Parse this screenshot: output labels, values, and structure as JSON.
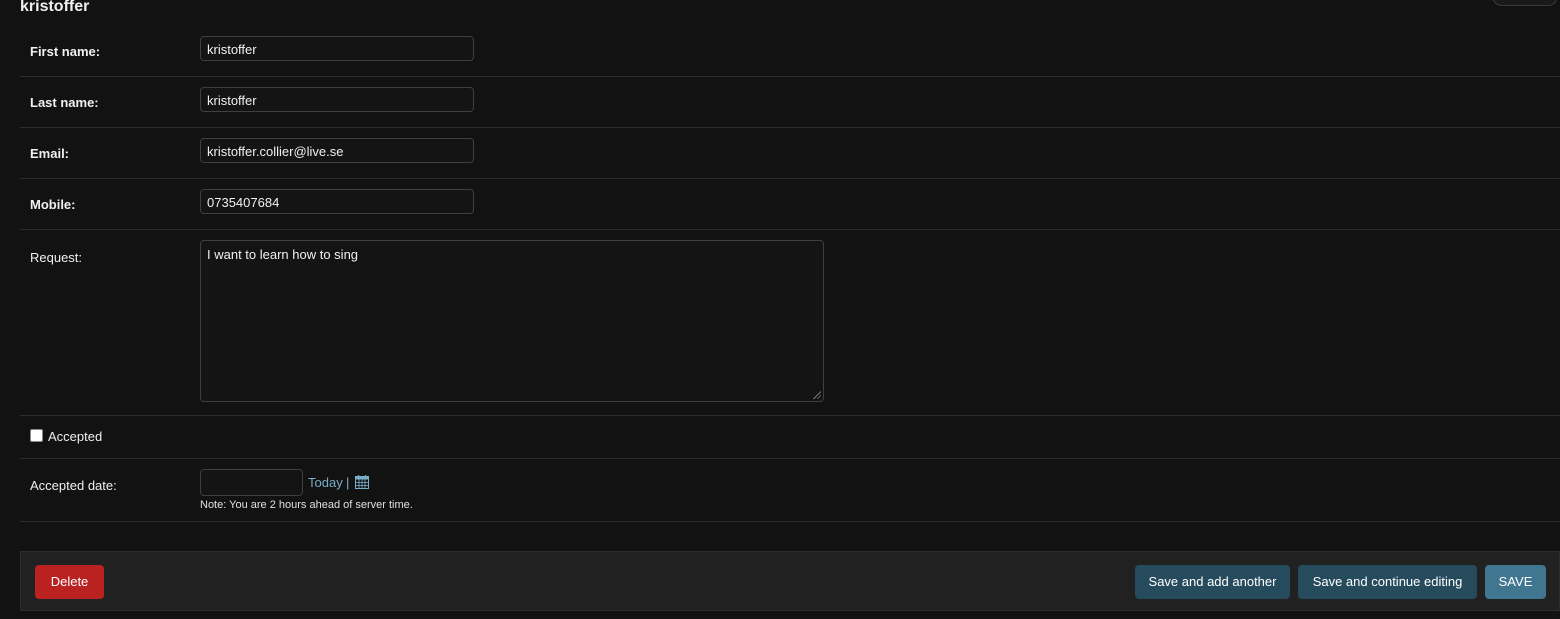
{
  "page": {
    "title": "kristoffer"
  },
  "fields": {
    "first_name": {
      "label": "First name:",
      "value": "kristoffer"
    },
    "last_name": {
      "label": "Last name:",
      "value": "kristoffer"
    },
    "email": {
      "label": "Email:",
      "value": "kristoffer.collier@live.se"
    },
    "mobile": {
      "label": "Mobile:",
      "value": "0735407684"
    },
    "request": {
      "label": "Request:",
      "value": "I want to learn how to sing"
    },
    "accepted": {
      "label": "Accepted",
      "checked": false
    },
    "accepted_date": {
      "label": "Accepted date:",
      "value": "",
      "today_link": "Today",
      "separator": "|",
      "calendar_icon": "calendar-icon",
      "note": "Note: You are 2 hours ahead of server time."
    }
  },
  "actions": {
    "delete_label": "Delete",
    "save_add_another_label": "Save and add another",
    "save_continue_label": "Save and continue editing",
    "save_label": "SAVE"
  },
  "colors": {
    "background": "#121212",
    "delete": "#ba2121",
    "secondary_button": "#264b5d",
    "save_button": "#417690",
    "link": "#79aec8"
  }
}
